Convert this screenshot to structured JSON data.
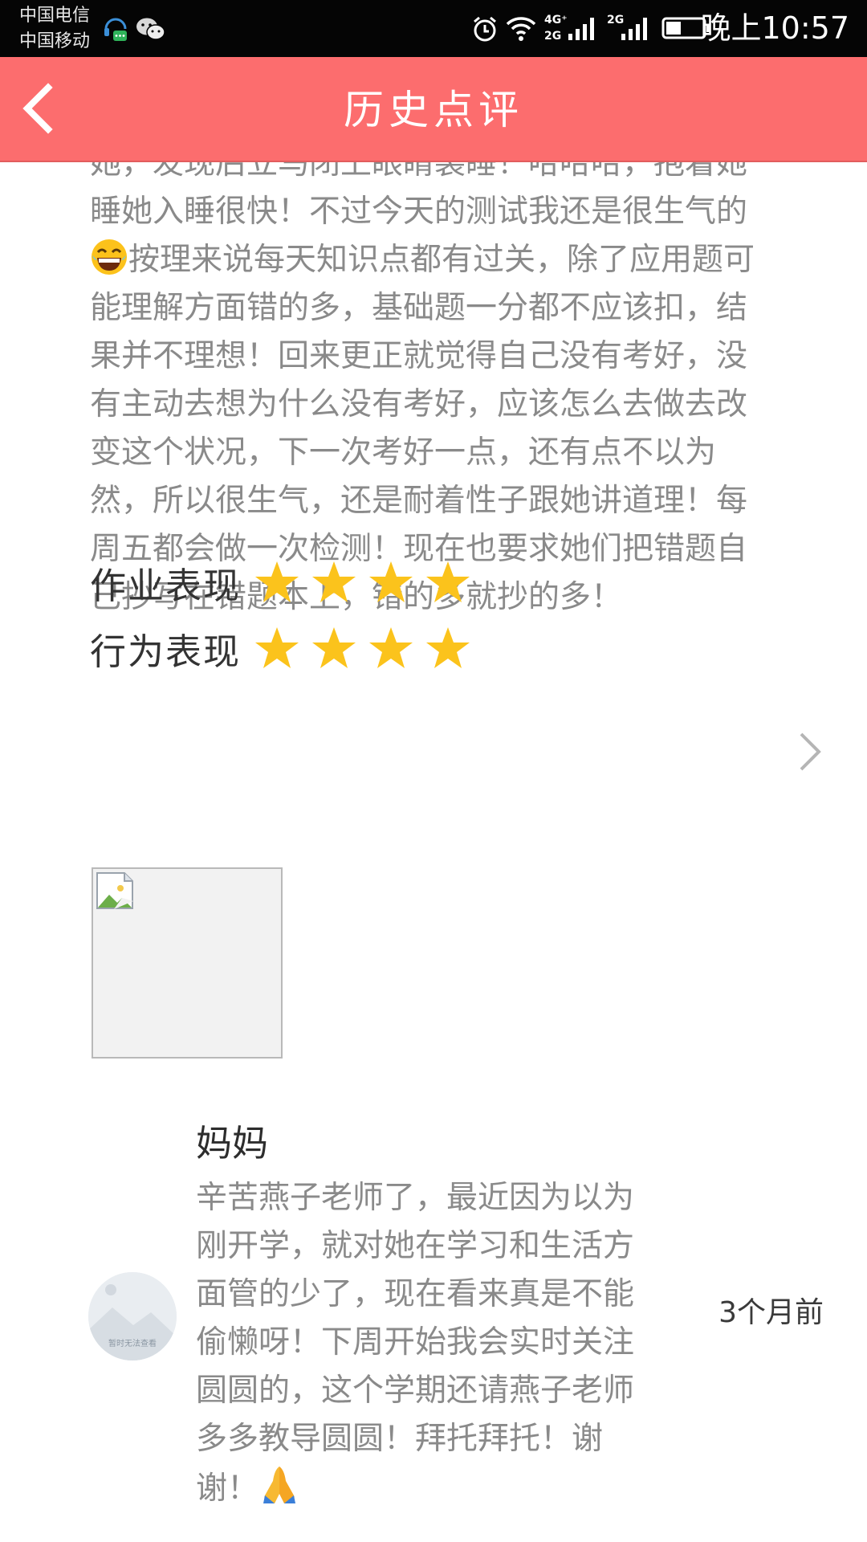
{
  "status_bar": {
    "carrier_1": "中国电信",
    "carrier_2": "中国移动",
    "network_1": "4G⁺",
    "network_1b": "2G",
    "network_2": "2G",
    "time": "晚上10:57"
  },
  "app_bar": {
    "title": "历史点评",
    "back_icon": "chevron-left-icon"
  },
  "teacher_comment": {
    "text_before_emoji": "她，发现后立马闭上眼睛装睡！哈哈哈，抱着她\n睡她入睡很快！不过今天的测试我还是很生气的\n",
    "emoji": "laughing-face-icon",
    "text_after_emoji": "按理来说每天知识点都有过关，除了应用题可\n能理解方面错的多，基础题一分都不应该扣，结\n果并不理想！回来更正就觉得自己没有考好，没\n有主动去想为什么没有考好，应该怎么去做去改\n变这个状况，下一次考好一点，还有点不以为\n然，所以很生气，还是耐着性子跟她讲道理！每\n周五都会做一次检测！现在也要求她们把错题自\n己抄写在错题本上，错的多就抄的多！"
  },
  "ratings": [
    {
      "label": "作业表现",
      "stars": 4,
      "max": 4
    },
    {
      "label": "行为表现",
      "stars": 4,
      "max": 4
    }
  ],
  "colors": {
    "app_bar": "#fc6d6e",
    "star": "#fbc31c",
    "comment_text": "#8a8a8a"
  },
  "photo": {
    "icon": "broken-image-icon"
  },
  "reply": {
    "author": "妈妈",
    "avatar_caption": "暂时无法查看",
    "text": "辛苦燕子老师了，最近因为以为\n刚开学，就对她在学习和生活方\n面管的少了，现在看来真是不能\n偷懒呀！下周开始我会实时关注\n圆圆的，这个学期还请燕子老师\n多多教导圆圆！拜托拜托！谢\n谢！",
    "emoji": "folded-hands-icon",
    "time": "3个月前"
  }
}
